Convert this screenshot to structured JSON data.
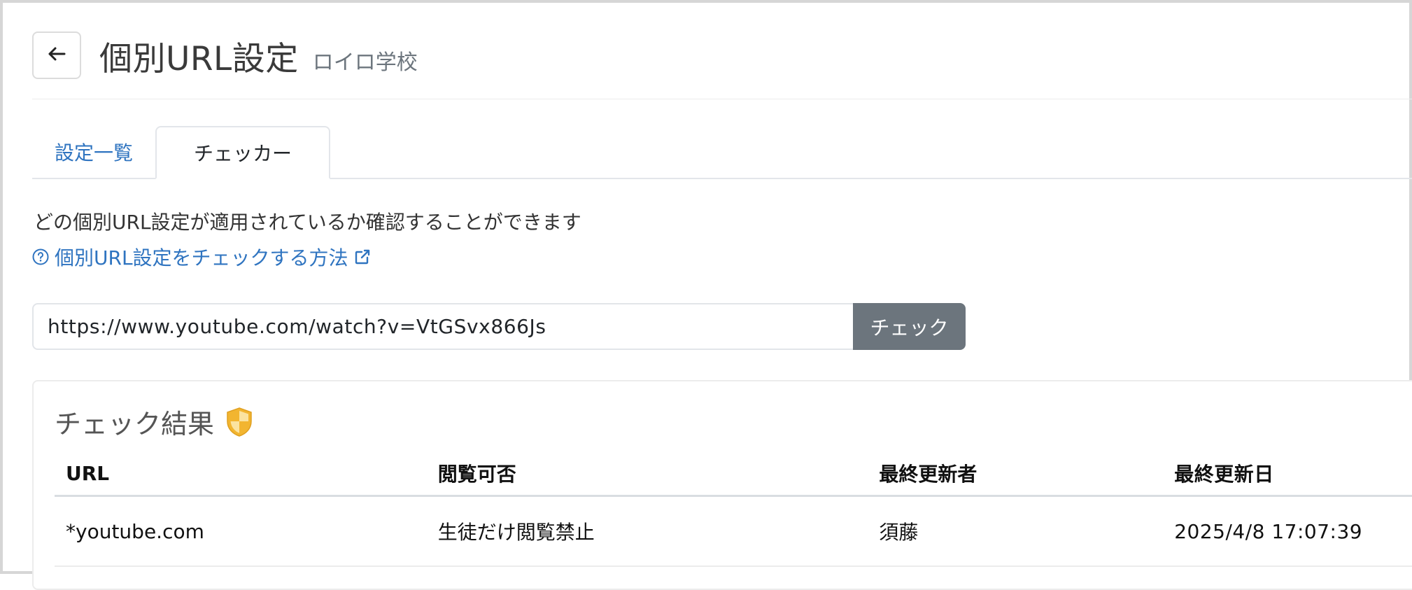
{
  "header": {
    "title": "個別URL設定",
    "subtitle": "ロイロ学校"
  },
  "tabs": [
    {
      "label": "設定一覧",
      "active": false
    },
    {
      "label": "チェッカー",
      "active": true
    }
  ],
  "checker": {
    "description": "どの個別URL設定が適用されているか確認することができます",
    "help_link": "個別URL設定をチェックする方法",
    "url_value": "https://www.youtube.com/watch?v=VtGSvx866Js",
    "check_button": "チェック"
  },
  "result": {
    "title": "チェック結果",
    "columns": {
      "url": "URL",
      "view": "閲覧可否",
      "updater": "最終更新者",
      "updated_at": "最終更新日"
    },
    "rows": [
      {
        "url": "*youtube.com",
        "view": "生徒だけ閲覧禁止",
        "updater": "須藤",
        "updated_at": "2025/4/8 17:07:39"
      }
    ]
  },
  "colors": {
    "link": "#2f74c0",
    "button_bg": "#6c757d",
    "shield": "#f2b530"
  },
  "icons": [
    "arrow-left-icon",
    "question-circle-icon",
    "external-link-icon",
    "shield-icon"
  ]
}
